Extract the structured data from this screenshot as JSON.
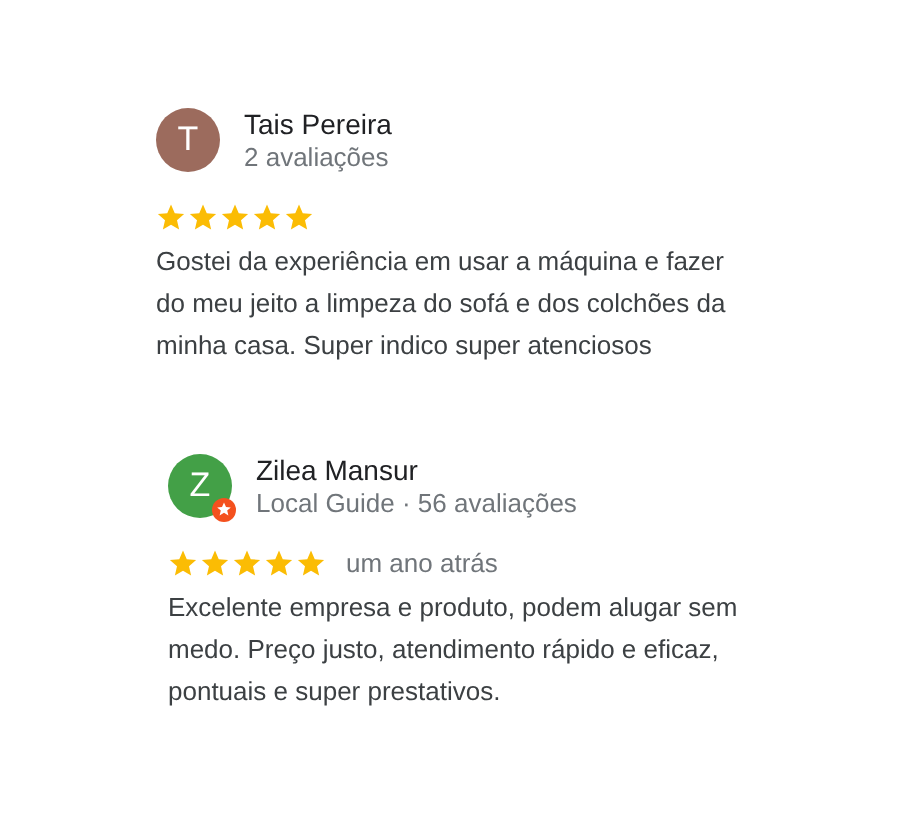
{
  "reviews": [
    {
      "initial": "T",
      "color": "#9c6b5d",
      "name": "Tais Pereira",
      "local_guide": false,
      "meta": "2 avaliações",
      "stars": 5,
      "text": "Gostei da experiência em usar a máquina e fazer do meu jeito a limpeza do sofá e dos colchões da minha casa. Super indico super atenciosos"
    },
    {
      "initial": "Z",
      "color": "#43a047",
      "name": "Zilea Mansur",
      "local_guide": true,
      "meta": "Local Guide · 56 avaliações",
      "stars": 5,
      "time": "um ano atrás",
      "text": "Excelente empresa e produto, podem alugar sem medo. Preço justo, atendimento rápido e eficaz, pontuais e super prestativos."
    }
  ]
}
